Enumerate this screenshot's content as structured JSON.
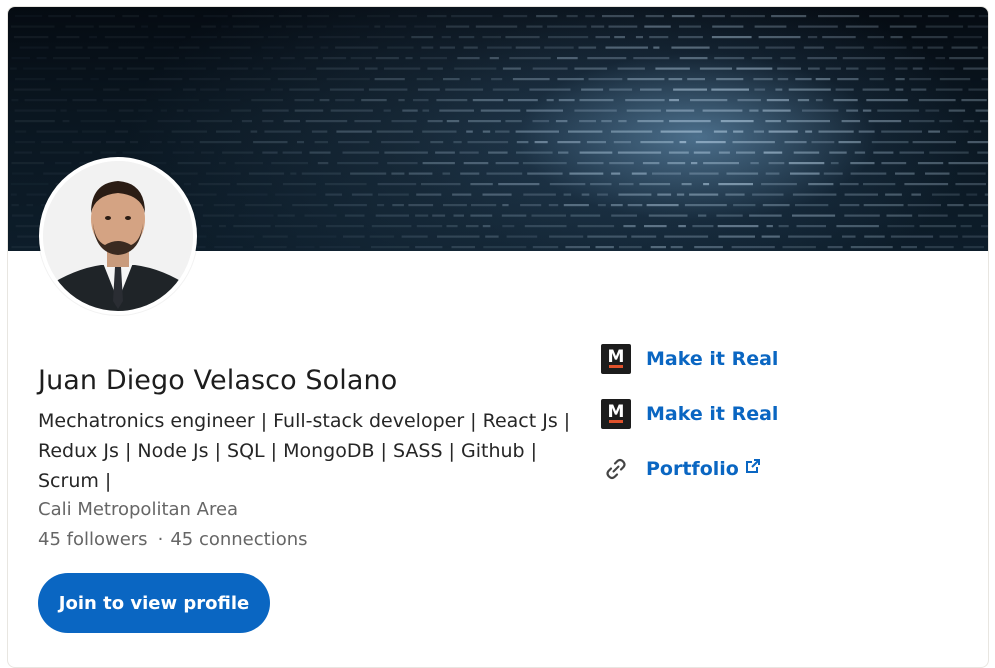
{
  "profile": {
    "name": "Juan Diego Velasco Solano",
    "headline": "Mechatronics engineer | Full-stack developer | React Js | Redux Js | Node Js | SQL | MongoDB | SASS | Github | Scrum |",
    "location": "Cali Metropolitan Area",
    "followers": "45 followers",
    "separator": "·",
    "connections": "45 connections"
  },
  "actions": {
    "join_label": "Join to view profile"
  },
  "links": [
    {
      "label": "Make it Real",
      "icon": "make-it-real-logo",
      "logo_letter": "M"
    },
    {
      "label": "Make it Real",
      "icon": "make-it-real-logo",
      "logo_letter": "M"
    },
    {
      "label": "Portfolio",
      "icon": "link-chain-icon",
      "external": true
    }
  ],
  "colors": {
    "accent": "#0a66c2",
    "banner_bg": "#0a1620",
    "logo_bar": "#e0522c"
  }
}
